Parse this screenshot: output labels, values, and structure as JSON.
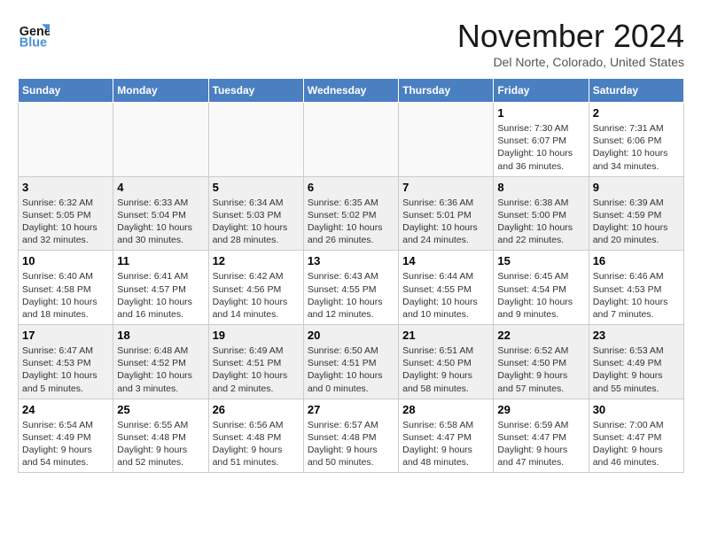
{
  "logo": {
    "line1": "General",
    "line2": "Blue"
  },
  "title": "November 2024",
  "location": "Del Norte, Colorado, United States",
  "days_of_week": [
    "Sunday",
    "Monday",
    "Tuesday",
    "Wednesday",
    "Thursday",
    "Friday",
    "Saturday"
  ],
  "weeks": [
    [
      {
        "day": "",
        "text": "",
        "empty": true
      },
      {
        "day": "",
        "text": "",
        "empty": true
      },
      {
        "day": "",
        "text": "",
        "empty": true
      },
      {
        "day": "",
        "text": "",
        "empty": true
      },
      {
        "day": "",
        "text": "",
        "empty": true
      },
      {
        "day": "1",
        "text": "Sunrise: 7:30 AM\nSunset: 6:07 PM\nDaylight: 10 hours\nand 36 minutes.",
        "empty": false
      },
      {
        "day": "2",
        "text": "Sunrise: 7:31 AM\nSunset: 6:06 PM\nDaylight: 10 hours\nand 34 minutes.",
        "empty": false
      }
    ],
    [
      {
        "day": "3",
        "text": "Sunrise: 6:32 AM\nSunset: 5:05 PM\nDaylight: 10 hours\nand 32 minutes.",
        "empty": false
      },
      {
        "day": "4",
        "text": "Sunrise: 6:33 AM\nSunset: 5:04 PM\nDaylight: 10 hours\nand 30 minutes.",
        "empty": false
      },
      {
        "day": "5",
        "text": "Sunrise: 6:34 AM\nSunset: 5:03 PM\nDaylight: 10 hours\nand 28 minutes.",
        "empty": false
      },
      {
        "day": "6",
        "text": "Sunrise: 6:35 AM\nSunset: 5:02 PM\nDaylight: 10 hours\nand 26 minutes.",
        "empty": false
      },
      {
        "day": "7",
        "text": "Sunrise: 6:36 AM\nSunset: 5:01 PM\nDaylight: 10 hours\nand 24 minutes.",
        "empty": false
      },
      {
        "day": "8",
        "text": "Sunrise: 6:38 AM\nSunset: 5:00 PM\nDaylight: 10 hours\nand 22 minutes.",
        "empty": false
      },
      {
        "day": "9",
        "text": "Sunrise: 6:39 AM\nSunset: 4:59 PM\nDaylight: 10 hours\nand 20 minutes.",
        "empty": false
      }
    ],
    [
      {
        "day": "10",
        "text": "Sunrise: 6:40 AM\nSunset: 4:58 PM\nDaylight: 10 hours\nand 18 minutes.",
        "empty": false
      },
      {
        "day": "11",
        "text": "Sunrise: 6:41 AM\nSunset: 4:57 PM\nDaylight: 10 hours\nand 16 minutes.",
        "empty": false
      },
      {
        "day": "12",
        "text": "Sunrise: 6:42 AM\nSunset: 4:56 PM\nDaylight: 10 hours\nand 14 minutes.",
        "empty": false
      },
      {
        "day": "13",
        "text": "Sunrise: 6:43 AM\nSunset: 4:55 PM\nDaylight: 10 hours\nand 12 minutes.",
        "empty": false
      },
      {
        "day": "14",
        "text": "Sunrise: 6:44 AM\nSunset: 4:55 PM\nDaylight: 10 hours\nand 10 minutes.",
        "empty": false
      },
      {
        "day": "15",
        "text": "Sunrise: 6:45 AM\nSunset: 4:54 PM\nDaylight: 10 hours\nand 9 minutes.",
        "empty": false
      },
      {
        "day": "16",
        "text": "Sunrise: 6:46 AM\nSunset: 4:53 PM\nDaylight: 10 hours\nand 7 minutes.",
        "empty": false
      }
    ],
    [
      {
        "day": "17",
        "text": "Sunrise: 6:47 AM\nSunset: 4:53 PM\nDaylight: 10 hours\nand 5 minutes.",
        "empty": false
      },
      {
        "day": "18",
        "text": "Sunrise: 6:48 AM\nSunset: 4:52 PM\nDaylight: 10 hours\nand 3 minutes.",
        "empty": false
      },
      {
        "day": "19",
        "text": "Sunrise: 6:49 AM\nSunset: 4:51 PM\nDaylight: 10 hours\nand 2 minutes.",
        "empty": false
      },
      {
        "day": "20",
        "text": "Sunrise: 6:50 AM\nSunset: 4:51 PM\nDaylight: 10 hours\nand 0 minutes.",
        "empty": false
      },
      {
        "day": "21",
        "text": "Sunrise: 6:51 AM\nSunset: 4:50 PM\nDaylight: 9 hours\nand 58 minutes.",
        "empty": false
      },
      {
        "day": "22",
        "text": "Sunrise: 6:52 AM\nSunset: 4:50 PM\nDaylight: 9 hours\nand 57 minutes.",
        "empty": false
      },
      {
        "day": "23",
        "text": "Sunrise: 6:53 AM\nSunset: 4:49 PM\nDaylight: 9 hours\nand 55 minutes.",
        "empty": false
      }
    ],
    [
      {
        "day": "24",
        "text": "Sunrise: 6:54 AM\nSunset: 4:49 PM\nDaylight: 9 hours\nand 54 minutes.",
        "empty": false
      },
      {
        "day": "25",
        "text": "Sunrise: 6:55 AM\nSunset: 4:48 PM\nDaylight: 9 hours\nand 52 minutes.",
        "empty": false
      },
      {
        "day": "26",
        "text": "Sunrise: 6:56 AM\nSunset: 4:48 PM\nDaylight: 9 hours\nand 51 minutes.",
        "empty": false
      },
      {
        "day": "27",
        "text": "Sunrise: 6:57 AM\nSunset: 4:48 PM\nDaylight: 9 hours\nand 50 minutes.",
        "empty": false
      },
      {
        "day": "28",
        "text": "Sunrise: 6:58 AM\nSunset: 4:47 PM\nDaylight: 9 hours\nand 48 minutes.",
        "empty": false
      },
      {
        "day": "29",
        "text": "Sunrise: 6:59 AM\nSunset: 4:47 PM\nDaylight: 9 hours\nand 47 minutes.",
        "empty": false
      },
      {
        "day": "30",
        "text": "Sunrise: 7:00 AM\nSunset: 4:47 PM\nDaylight: 9 hours\nand 46 minutes.",
        "empty": false
      }
    ]
  ],
  "shaded_rows": [
    1,
    3
  ]
}
